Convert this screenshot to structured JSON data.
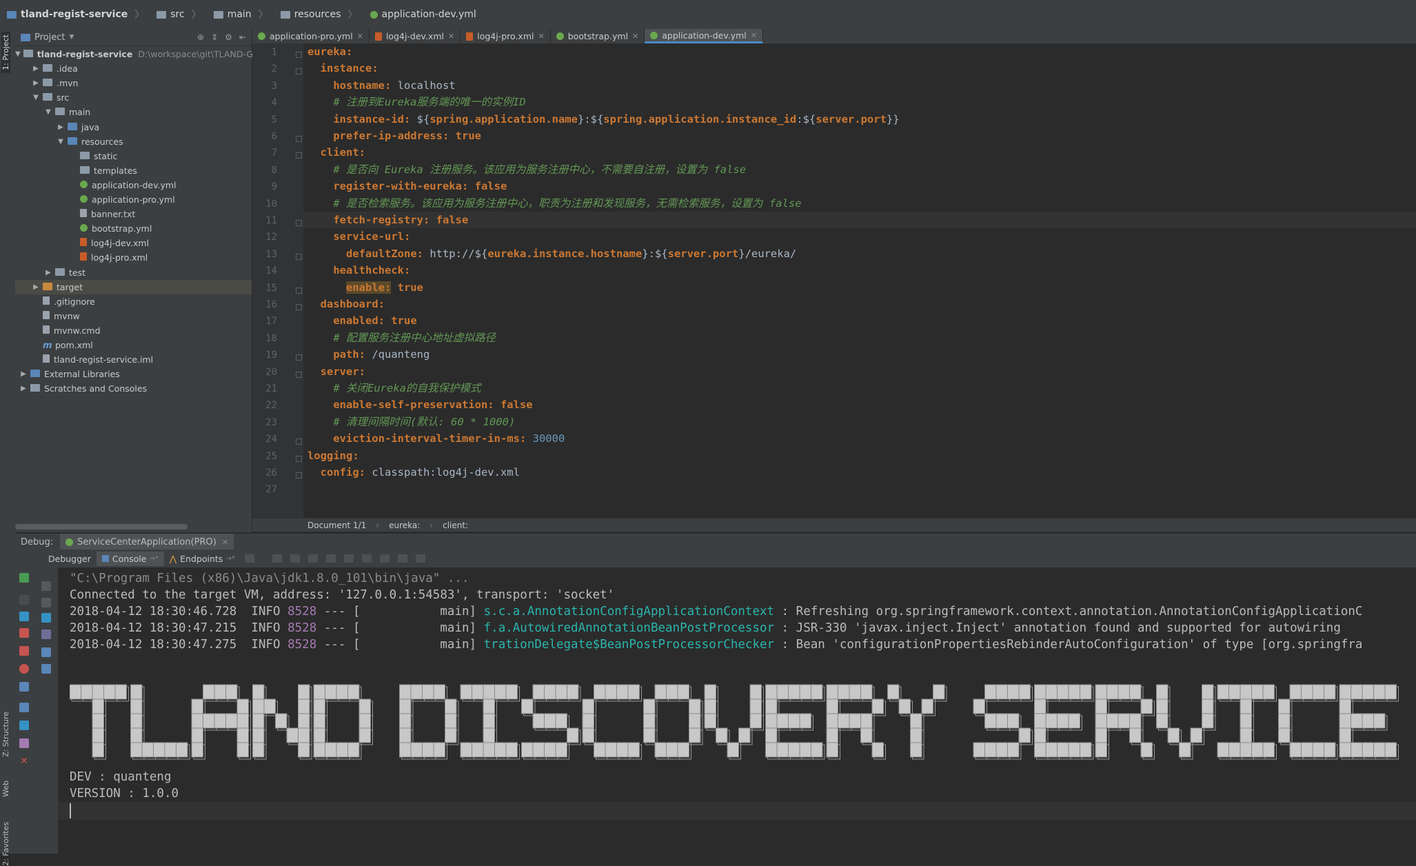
{
  "breadcrumb": [
    "tland-regist-service",
    "src",
    "main",
    "resources",
    "application-dev.yml"
  ],
  "left_strip": {
    "project": "1: Project",
    "structure": "Z: Structure",
    "web": "Web",
    "favorites": "2: Favorites"
  },
  "project_panel": {
    "title": "Project",
    "tree": [
      {
        "label": "tland-regist-service",
        "hint": "D:\\workspace\\git\\TLAND-GPLU",
        "icon": "folder-icon",
        "expanded": true
      },
      {
        "label": ".idea",
        "icon": "folder-icon"
      },
      {
        "label": ".mvn",
        "icon": "folder-icon"
      },
      {
        "label": "src",
        "icon": "folder-icon",
        "expanded": true
      },
      {
        "label": "main",
        "icon": "folder-icon",
        "expanded": true
      },
      {
        "label": "java",
        "icon": "folder-icon"
      },
      {
        "label": "resources",
        "icon": "folder-icon",
        "expanded": true
      },
      {
        "label": "static",
        "icon": "folder-icon"
      },
      {
        "label": "templates",
        "icon": "folder-icon"
      },
      {
        "label": "application-dev.yml",
        "icon": "yml-icon"
      },
      {
        "label": "application-pro.yml",
        "icon": "yml-icon"
      },
      {
        "label": "banner.txt",
        "icon": "file-icon"
      },
      {
        "label": "bootstrap.yml",
        "icon": "yml-icon"
      },
      {
        "label": "log4j-dev.xml",
        "icon": "xml-icon"
      },
      {
        "label": "log4j-pro.xml",
        "icon": "xml-icon"
      },
      {
        "label": "test",
        "icon": "folder-icon"
      },
      {
        "label": "target",
        "icon": "folder-icon"
      },
      {
        "label": ".gitignore",
        "icon": "file-icon"
      },
      {
        "label": "mvnw",
        "icon": "file-icon"
      },
      {
        "label": "mvnw.cmd",
        "icon": "file-icon"
      },
      {
        "label": "pom.xml",
        "icon": "maven-icon"
      },
      {
        "label": "tland-regist-service.iml",
        "icon": "file-icon"
      },
      {
        "label": "External Libraries",
        "icon": "library-icon"
      },
      {
        "label": "Scratches and Consoles",
        "icon": "scratch-icon"
      }
    ]
  },
  "editor": {
    "tabs": [
      "application-pro.yml",
      "log4j-dev.xml",
      "log4j-pro.xml",
      "bootstrap.yml",
      "application-dev.yml"
    ],
    "active_tab": "application-dev.yml",
    "line_numbers": [
      "1",
      "2",
      "3",
      "4",
      "5",
      "6",
      "7",
      "8",
      "9",
      "10",
      "11",
      "12",
      "13",
      "14",
      "15",
      "16",
      "17",
      "18",
      "19",
      "20",
      "21",
      "22",
      "23",
      "24",
      "25",
      "26",
      "27"
    ],
    "lines": [
      "eureka:",
      "  instance:",
      "    hostname: localhost",
      "    # 注册到Eureka服务端的唯一的实例ID",
      "    instance-id: ${spring.application.name}:${spring.application.instance_id:${server.port}}",
      "    prefer-ip-address: true",
      "  client:",
      "    # 是否向 Eureka 注册服务。该应用为服务注册中心，不需要自注册，设置为 false",
      "    register-with-eureka: false",
      "    # 是否检索服务。该应用为服务注册中心，职责为注册和发现服务，无需检索服务，设置为 false",
      "    fetch-registry: false",
      "    service-url:",
      "      defaultZone: http://${eureka.instance.hostname}:${server.port}/eureka/",
      "    healthcheck:",
      "      enable: true",
      "  dashboard:",
      "    enabled: true",
      "    # 配置服务注册中心地址虚拟路径",
      "    path: /quanteng",
      "  server:",
      "    # 关闭Eureka的自我保护模式",
      "    enable-self-preservation: false",
      "    # 清理间隔时间(默认: 60 * 1000)",
      "    eviction-interval-timer-in-ms: 30000",
      "logging:",
      "  config: classpath:log4j-dev.xml",
      ""
    ],
    "status": [
      "Document 1/1",
      "eureka:",
      "client:"
    ]
  },
  "debug": {
    "label": "Debug:",
    "run_config": "ServiceCenterApplication(PRO)",
    "tabs": [
      "Debugger",
      "Console",
      "Endpoints"
    ],
    "console_lines": {
      "l1": "\"C:\\Program Files (x86)\\Java\\jdk1.8.0_101\\bin\\java\" ...",
      "l2": "Connected to the target VM, address: '127.0.0.1:54583', transport: 'socket'",
      "logs": [
        {
          "ts": "2018-04-12 18:30:46.728",
          "level": "INFO",
          "pid": "8528",
          "thread": "--- [           main]",
          "cls": "s.c.a.AnnotationConfigApplicationContext",
          "msg": " : Refreshing org.springframework.context.annotation.AnnotationConfigApplicationC"
        },
        {
          "ts": "2018-04-12 18:30:47.215",
          "level": "INFO",
          "pid": "8528",
          "thread": "--- [           main]",
          "cls": "f.a.AutowiredAnnotationBeanPostProcessor",
          "msg": " : JSR-330 'javax.inject.Inject' annotation found and supported for autowiring"
        },
        {
          "ts": "2018-04-12 18:30:47.275",
          "level": "INFO",
          "pid": "8528",
          "thread": "--- [           main]",
          "cls": "trationDelegate$BeanPostProcessorChecker",
          "msg": " : Bean 'configurationPropertiesRebinderAutoConfiguration' of type [org.springfra"
        }
      ],
      "banner": "TLAND DISCOVERY SERVICE",
      "dev": "DEV : quanteng",
      "version": "VERSION : 1.0.0"
    }
  },
  "colors": {
    "accent": "#4a88c7",
    "keyword": "#cc7832",
    "comment": "#629755",
    "number": "#6897bb",
    "logger": "#2bb5ad"
  }
}
